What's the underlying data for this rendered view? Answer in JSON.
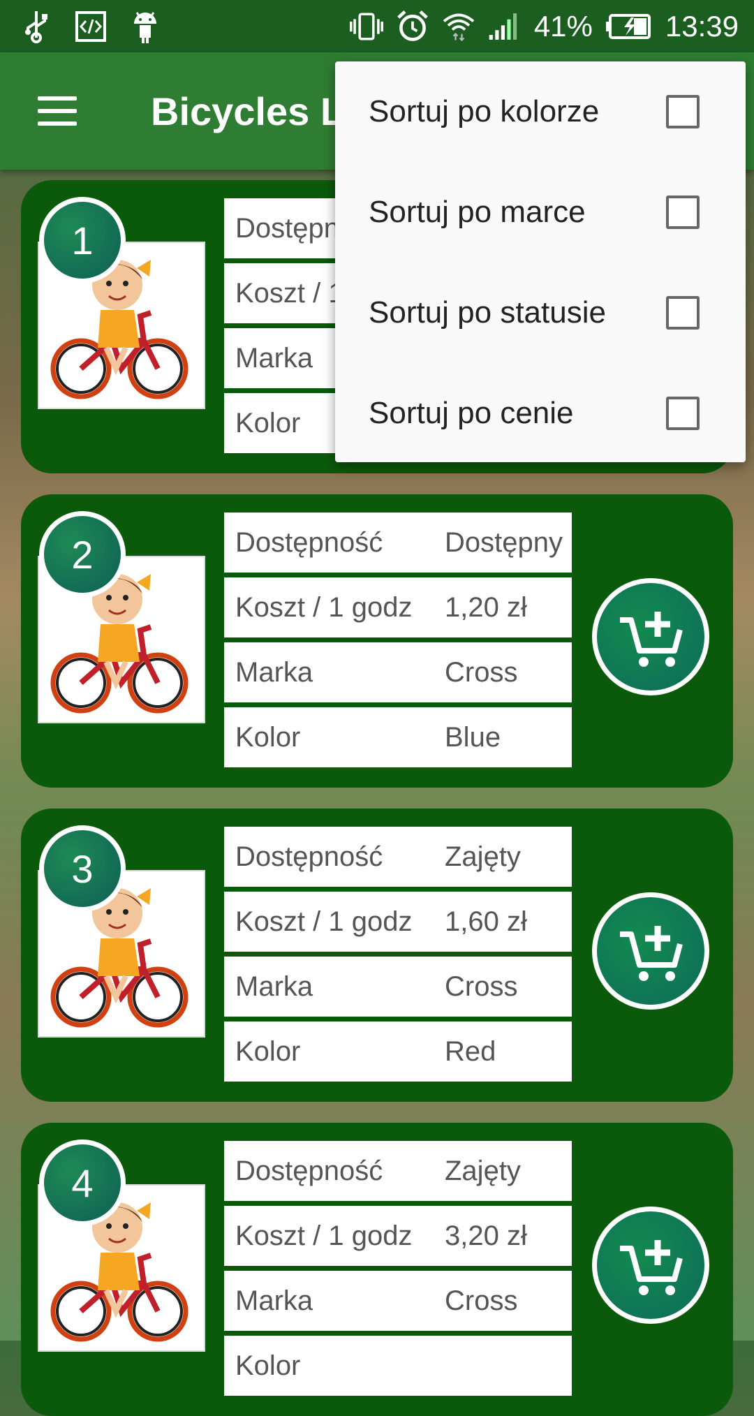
{
  "status_bar": {
    "battery": "41%",
    "time": "13:39",
    "icons_left": [
      "usb-icon",
      "code-icon",
      "android-icon"
    ],
    "icons_right": [
      "vibrate-icon",
      "alarm-icon",
      "wifi-icon",
      "signal-icon",
      "battery-charging-icon"
    ]
  },
  "app_bar": {
    "title": "Bicycles L",
    "menu_icon": "hamburger-icon"
  },
  "sort_menu": {
    "items": [
      {
        "label": "Sortuj po kolorze",
        "checked": false
      },
      {
        "label": "Sortuj po marce",
        "checked": false
      },
      {
        "label": "Sortuj po statusie",
        "checked": false
      },
      {
        "label": "Sortuj po cenie",
        "checked": false
      }
    ]
  },
  "bikes": [
    {
      "number": "1",
      "rows": [
        {
          "key": "Dostępność",
          "value": ""
        },
        {
          "key": "Koszt / 1 godz",
          "value": ""
        },
        {
          "key": "Marka",
          "value": ""
        },
        {
          "key": "Kolor",
          "value": ""
        }
      ]
    },
    {
      "number": "2",
      "rows": [
        {
          "key": "Dostępność",
          "value": "Dostępny"
        },
        {
          "key": "Koszt / 1 godz",
          "value": "1,20 zł"
        },
        {
          "key": "Marka",
          "value": "Cross"
        },
        {
          "key": "Kolor",
          "value": "Blue"
        }
      ]
    },
    {
      "number": "3",
      "rows": [
        {
          "key": "Dostępność",
          "value": "Zajęty"
        },
        {
          "key": "Koszt / 1 godz",
          "value": "1,60 zł"
        },
        {
          "key": "Marka",
          "value": "Cross"
        },
        {
          "key": "Kolor",
          "value": "Red"
        }
      ]
    },
    {
      "number": "4",
      "rows": [
        {
          "key": "Dostępność",
          "value": "Zajęty"
        },
        {
          "key": "Koszt / 1 godz",
          "value": "3,20 zł"
        },
        {
          "key": "Marka",
          "value": "Cross"
        },
        {
          "key": "Kolor",
          "value": ""
        }
      ]
    }
  ],
  "colors": {
    "status_bar": "#1c5e20",
    "app_bar": "#2e7d32",
    "card": "#0b5a0b",
    "accent": "#138a4f"
  }
}
